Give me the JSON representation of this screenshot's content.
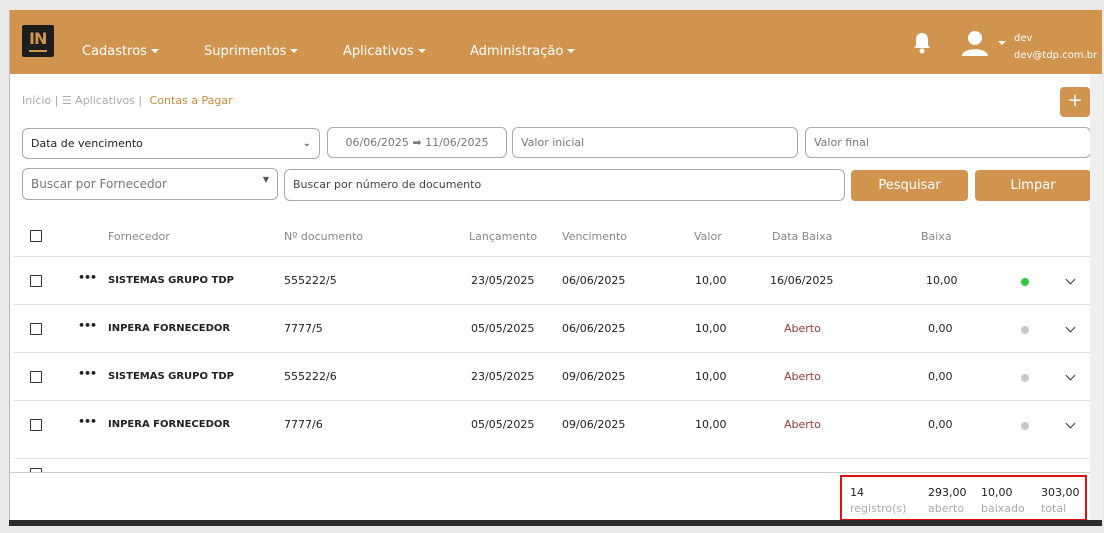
{
  "nav": {
    "logo_text": "IN",
    "menus": [
      "Cadastros",
      "Suprimentos",
      "Aplicativos",
      "Administração"
    ],
    "user_name": "dev",
    "user_email": "dev@tdp.com.br",
    "accent_color": "#d0944e"
  },
  "breadcrumb": {
    "home": "Início |",
    "apps": "☰ Aplicativos |",
    "current": "Contas a Pagar"
  },
  "add_button": "+",
  "filters": {
    "date_field": "Data de vencimento",
    "date_range": "06/06/2025 ➡ 11/06/2025",
    "valor_inicial": "Valor inicial",
    "valor_final": "Valor final",
    "fornecedor_placeholder": "Buscar por Fornecedor",
    "documento_placeholder": "Buscar por número de documento",
    "search_button": "Pesquisar",
    "clear_button": "Limpar"
  },
  "table": {
    "headers": [
      "Fornecedor",
      "Nº documento",
      "Lançamento",
      "Vencimento",
      "Valor",
      "Data Baixa",
      "Baixa"
    ],
    "rows": [
      {
        "fornecedor": "SISTEMAS GRUPO TDP",
        "documento": "555222/5",
        "lancamento": "23/05/2025",
        "vencimento": "06/06/2025",
        "valor": "10,00",
        "data_baixa": "16/06/2025",
        "baixa": "10,00",
        "status_color": "#2ecc40"
      },
      {
        "fornecedor": "INPERA FORNECEDOR",
        "documento": "7777/5",
        "lancamento": "05/05/2025",
        "vencimento": "06/06/2025",
        "valor": "10,00",
        "data_baixa": "Aberto",
        "baixa": "0,00",
        "status_color": "#c8c8c8"
      },
      {
        "fornecedor": "SISTEMAS GRUPO TDP",
        "documento": "555222/6",
        "lancamento": "23/05/2025",
        "vencimento": "09/06/2025",
        "valor": "10,00",
        "data_baixa": "Aberto",
        "baixa": "0,00",
        "status_color": "#c8c8c8"
      },
      {
        "fornecedor": "INPERA FORNECEDOR",
        "documento": "7777/6",
        "lancamento": "05/05/2025",
        "vencimento": "09/06/2025",
        "valor": "10,00",
        "data_baixa": "Aberto",
        "baixa": "0,00",
        "status_color": "#c8c8c8"
      }
    ]
  },
  "totals": {
    "count": "14",
    "count_label": "registro(s)",
    "aberto": "293,00",
    "aberto_label": "aberto",
    "baixado": "10,00",
    "baixado_label": "baixado",
    "total": "303,00",
    "total_label": "total"
  }
}
